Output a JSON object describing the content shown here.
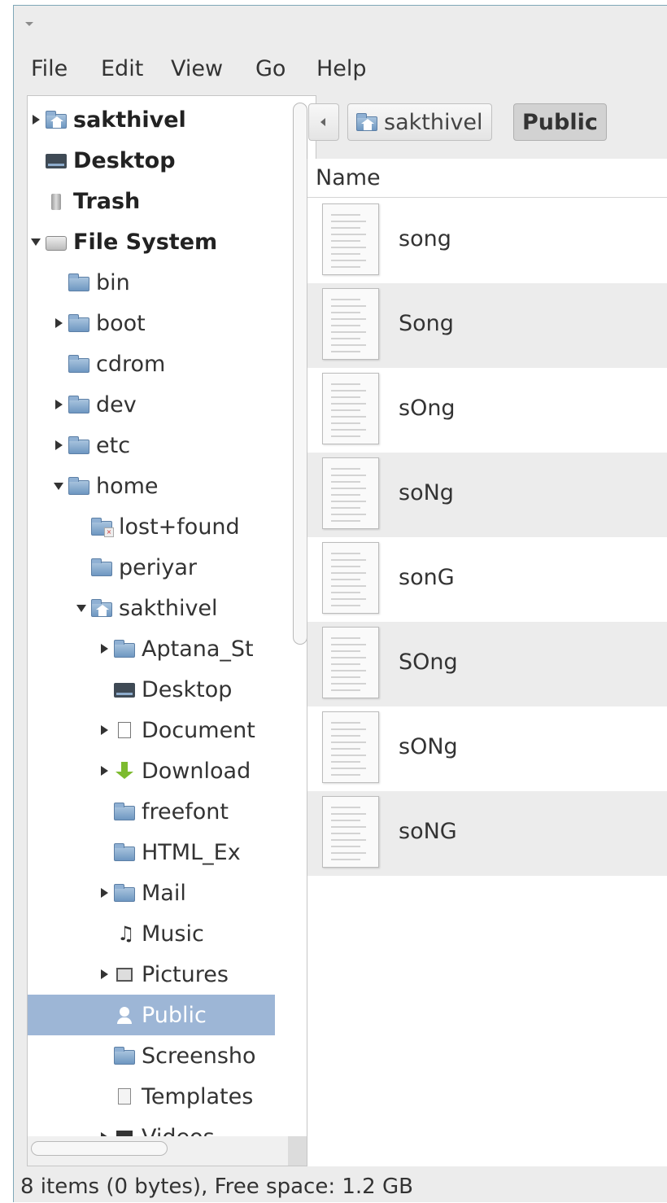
{
  "menubar": {
    "items": [
      "File",
      "Edit",
      "View",
      "Go",
      "Help"
    ]
  },
  "sidebar": {
    "places": [
      {
        "label": "sakthivel",
        "icon": "home-folder-icon",
        "expander": "closed"
      },
      {
        "label": "Desktop",
        "icon": "desktop-icon",
        "expander": "none"
      },
      {
        "label": "Trash",
        "icon": "trash-icon",
        "expander": "none"
      },
      {
        "label": "File System",
        "icon": "drive-icon",
        "expander": "open"
      }
    ],
    "tree": [
      {
        "label": "bin",
        "icon": "folder-icon",
        "expander": "none",
        "depth": 1
      },
      {
        "label": "boot",
        "icon": "folder-icon",
        "expander": "closed",
        "depth": 1
      },
      {
        "label": "cdrom",
        "icon": "folder-icon",
        "expander": "none",
        "depth": 1
      },
      {
        "label": "dev",
        "icon": "folder-icon",
        "expander": "closed",
        "depth": 1
      },
      {
        "label": "etc",
        "icon": "folder-icon",
        "expander": "closed",
        "depth": 1
      },
      {
        "label": "home",
        "icon": "folder-icon",
        "expander": "open",
        "depth": 1
      },
      {
        "label": "lost+found",
        "icon": "lost-found-icon",
        "expander": "none",
        "depth": 2
      },
      {
        "label": "periyar",
        "icon": "folder-icon",
        "expander": "none",
        "depth": 2
      },
      {
        "label": "sakthivel",
        "icon": "home-folder-icon",
        "expander": "open",
        "depth": 2
      },
      {
        "label": "Aptana_St",
        "icon": "folder-icon",
        "expander": "closed",
        "depth": 3
      },
      {
        "label": "Desktop",
        "icon": "desktop-icon",
        "expander": "none",
        "depth": 3
      },
      {
        "label": "Document",
        "icon": "documents-icon",
        "expander": "closed",
        "depth": 3
      },
      {
        "label": "Download",
        "icon": "download-icon",
        "expander": "closed",
        "depth": 3
      },
      {
        "label": "freefont",
        "icon": "folder-icon",
        "expander": "none",
        "depth": 3
      },
      {
        "label": "HTML_Ex",
        "icon": "folder-icon",
        "expander": "none",
        "depth": 3
      },
      {
        "label": "Mail",
        "icon": "folder-icon",
        "expander": "closed",
        "depth": 3
      },
      {
        "label": "Music",
        "icon": "music-icon",
        "expander": "none",
        "depth": 3
      },
      {
        "label": "Pictures",
        "icon": "pictures-icon",
        "expander": "closed",
        "depth": 3
      },
      {
        "label": "Public",
        "icon": "public-icon",
        "expander": "none",
        "depth": 3,
        "selected": true
      },
      {
        "label": "Screensho",
        "icon": "folder-icon",
        "expander": "none",
        "depth": 3
      },
      {
        "label": "Templates",
        "icon": "templates-icon",
        "expander": "none",
        "depth": 3
      },
      {
        "label": "Videos",
        "icon": "videos-icon",
        "expander": "closed",
        "depth": 3
      }
    ]
  },
  "pathbar": {
    "segments": [
      {
        "label": "sakthivel",
        "icon": "home-folder-icon",
        "active": false
      },
      {
        "label": "Public",
        "active": true
      }
    ]
  },
  "filelist": {
    "column_header": "Name",
    "files": [
      "song",
      "Song",
      "sOng",
      "soNg",
      "sonG",
      "SOng",
      "sONg",
      "soNG"
    ]
  },
  "statusbar": {
    "text": "8 items (0 bytes), Free space: 1.2 GB"
  },
  "colors": {
    "selection": "#9db6d6",
    "folder": "#6e97c1",
    "window_border": "#7fa7b8"
  }
}
